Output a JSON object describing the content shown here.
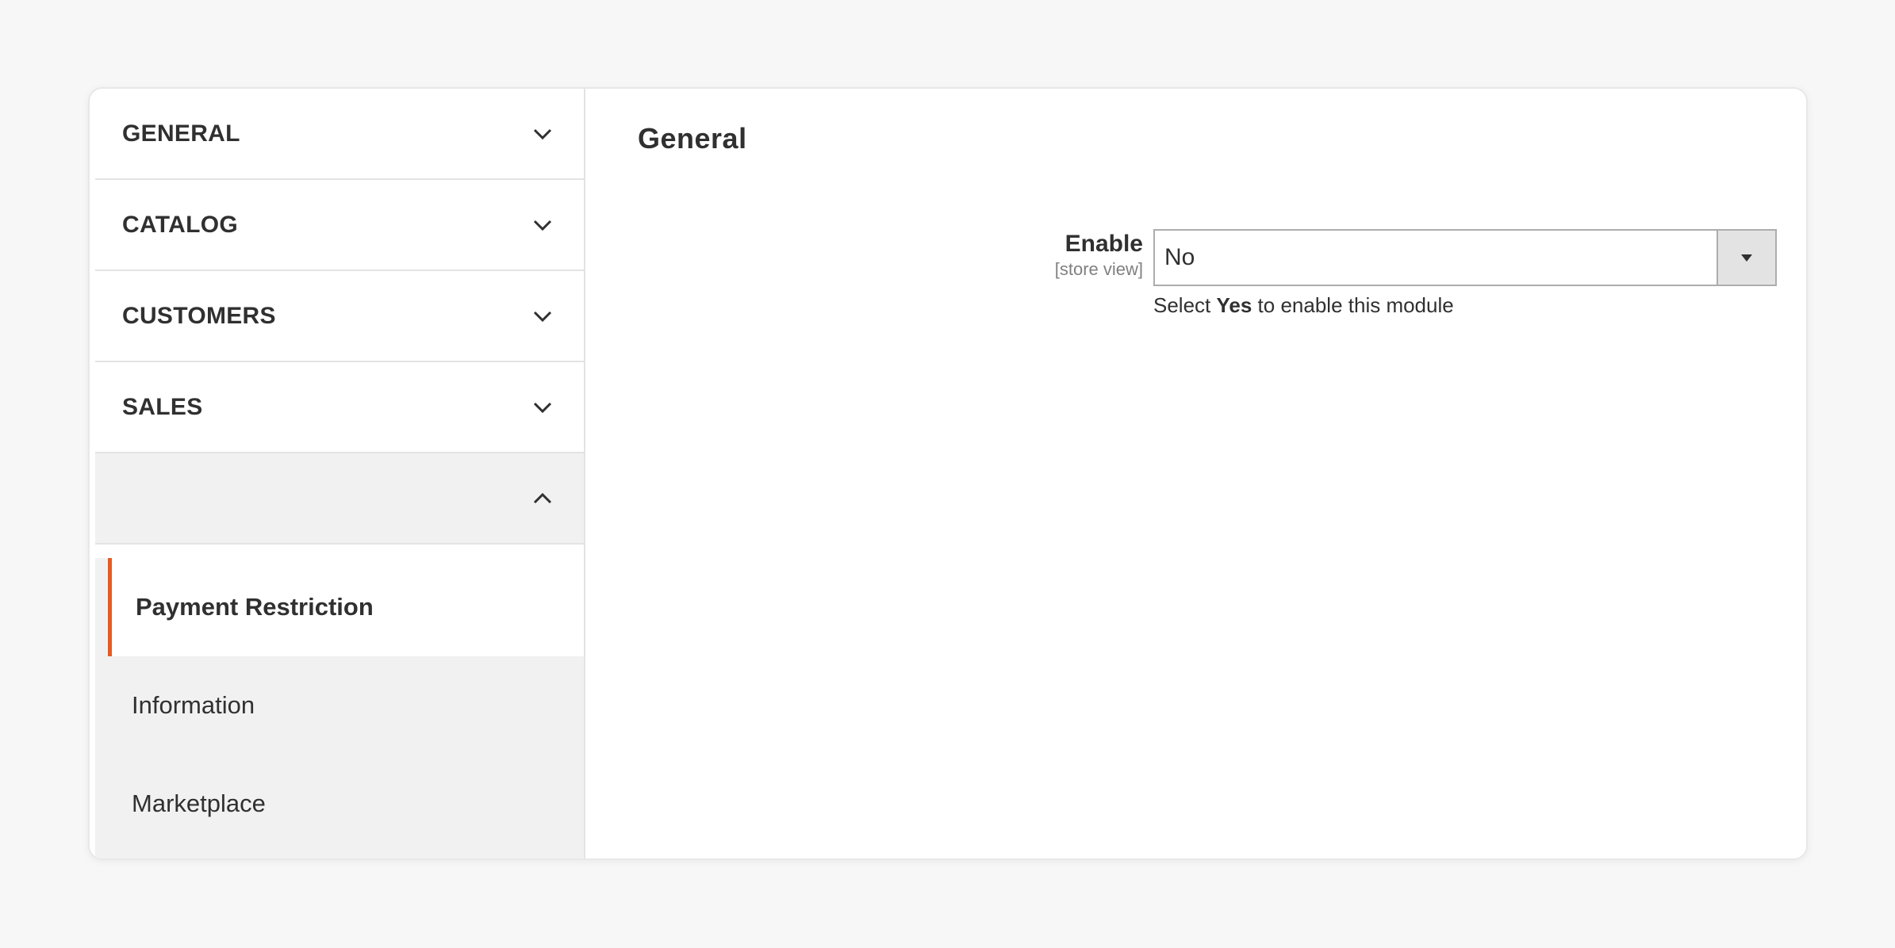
{
  "sidebar": {
    "sections": [
      {
        "title": "GENERAL"
      },
      {
        "title": "CATALOG"
      },
      {
        "title": "CUSTOMERS"
      },
      {
        "title": "SALES"
      },
      {
        "title": ""
      }
    ],
    "sub_items": [
      {
        "label": "Payment Restriction"
      },
      {
        "label": "Information"
      },
      {
        "label": "Marketplace"
      }
    ]
  },
  "main": {
    "title": "General",
    "field": {
      "label": "Enable",
      "scope": "[store view]",
      "value": "No"
    },
    "note": {
      "prefix": "Select ",
      "bold": "Yes",
      "suffix": " to enable this module"
    }
  },
  "colors": {
    "accent": "#e35b25",
    "submenu_bg": "#f1f1f1",
    "page_bg": "#f7f7f7"
  },
  "icons": {
    "collapsed": "chevron-down-icon",
    "expanded": "chevron-up-icon",
    "select": "caret-down-icon"
  }
}
